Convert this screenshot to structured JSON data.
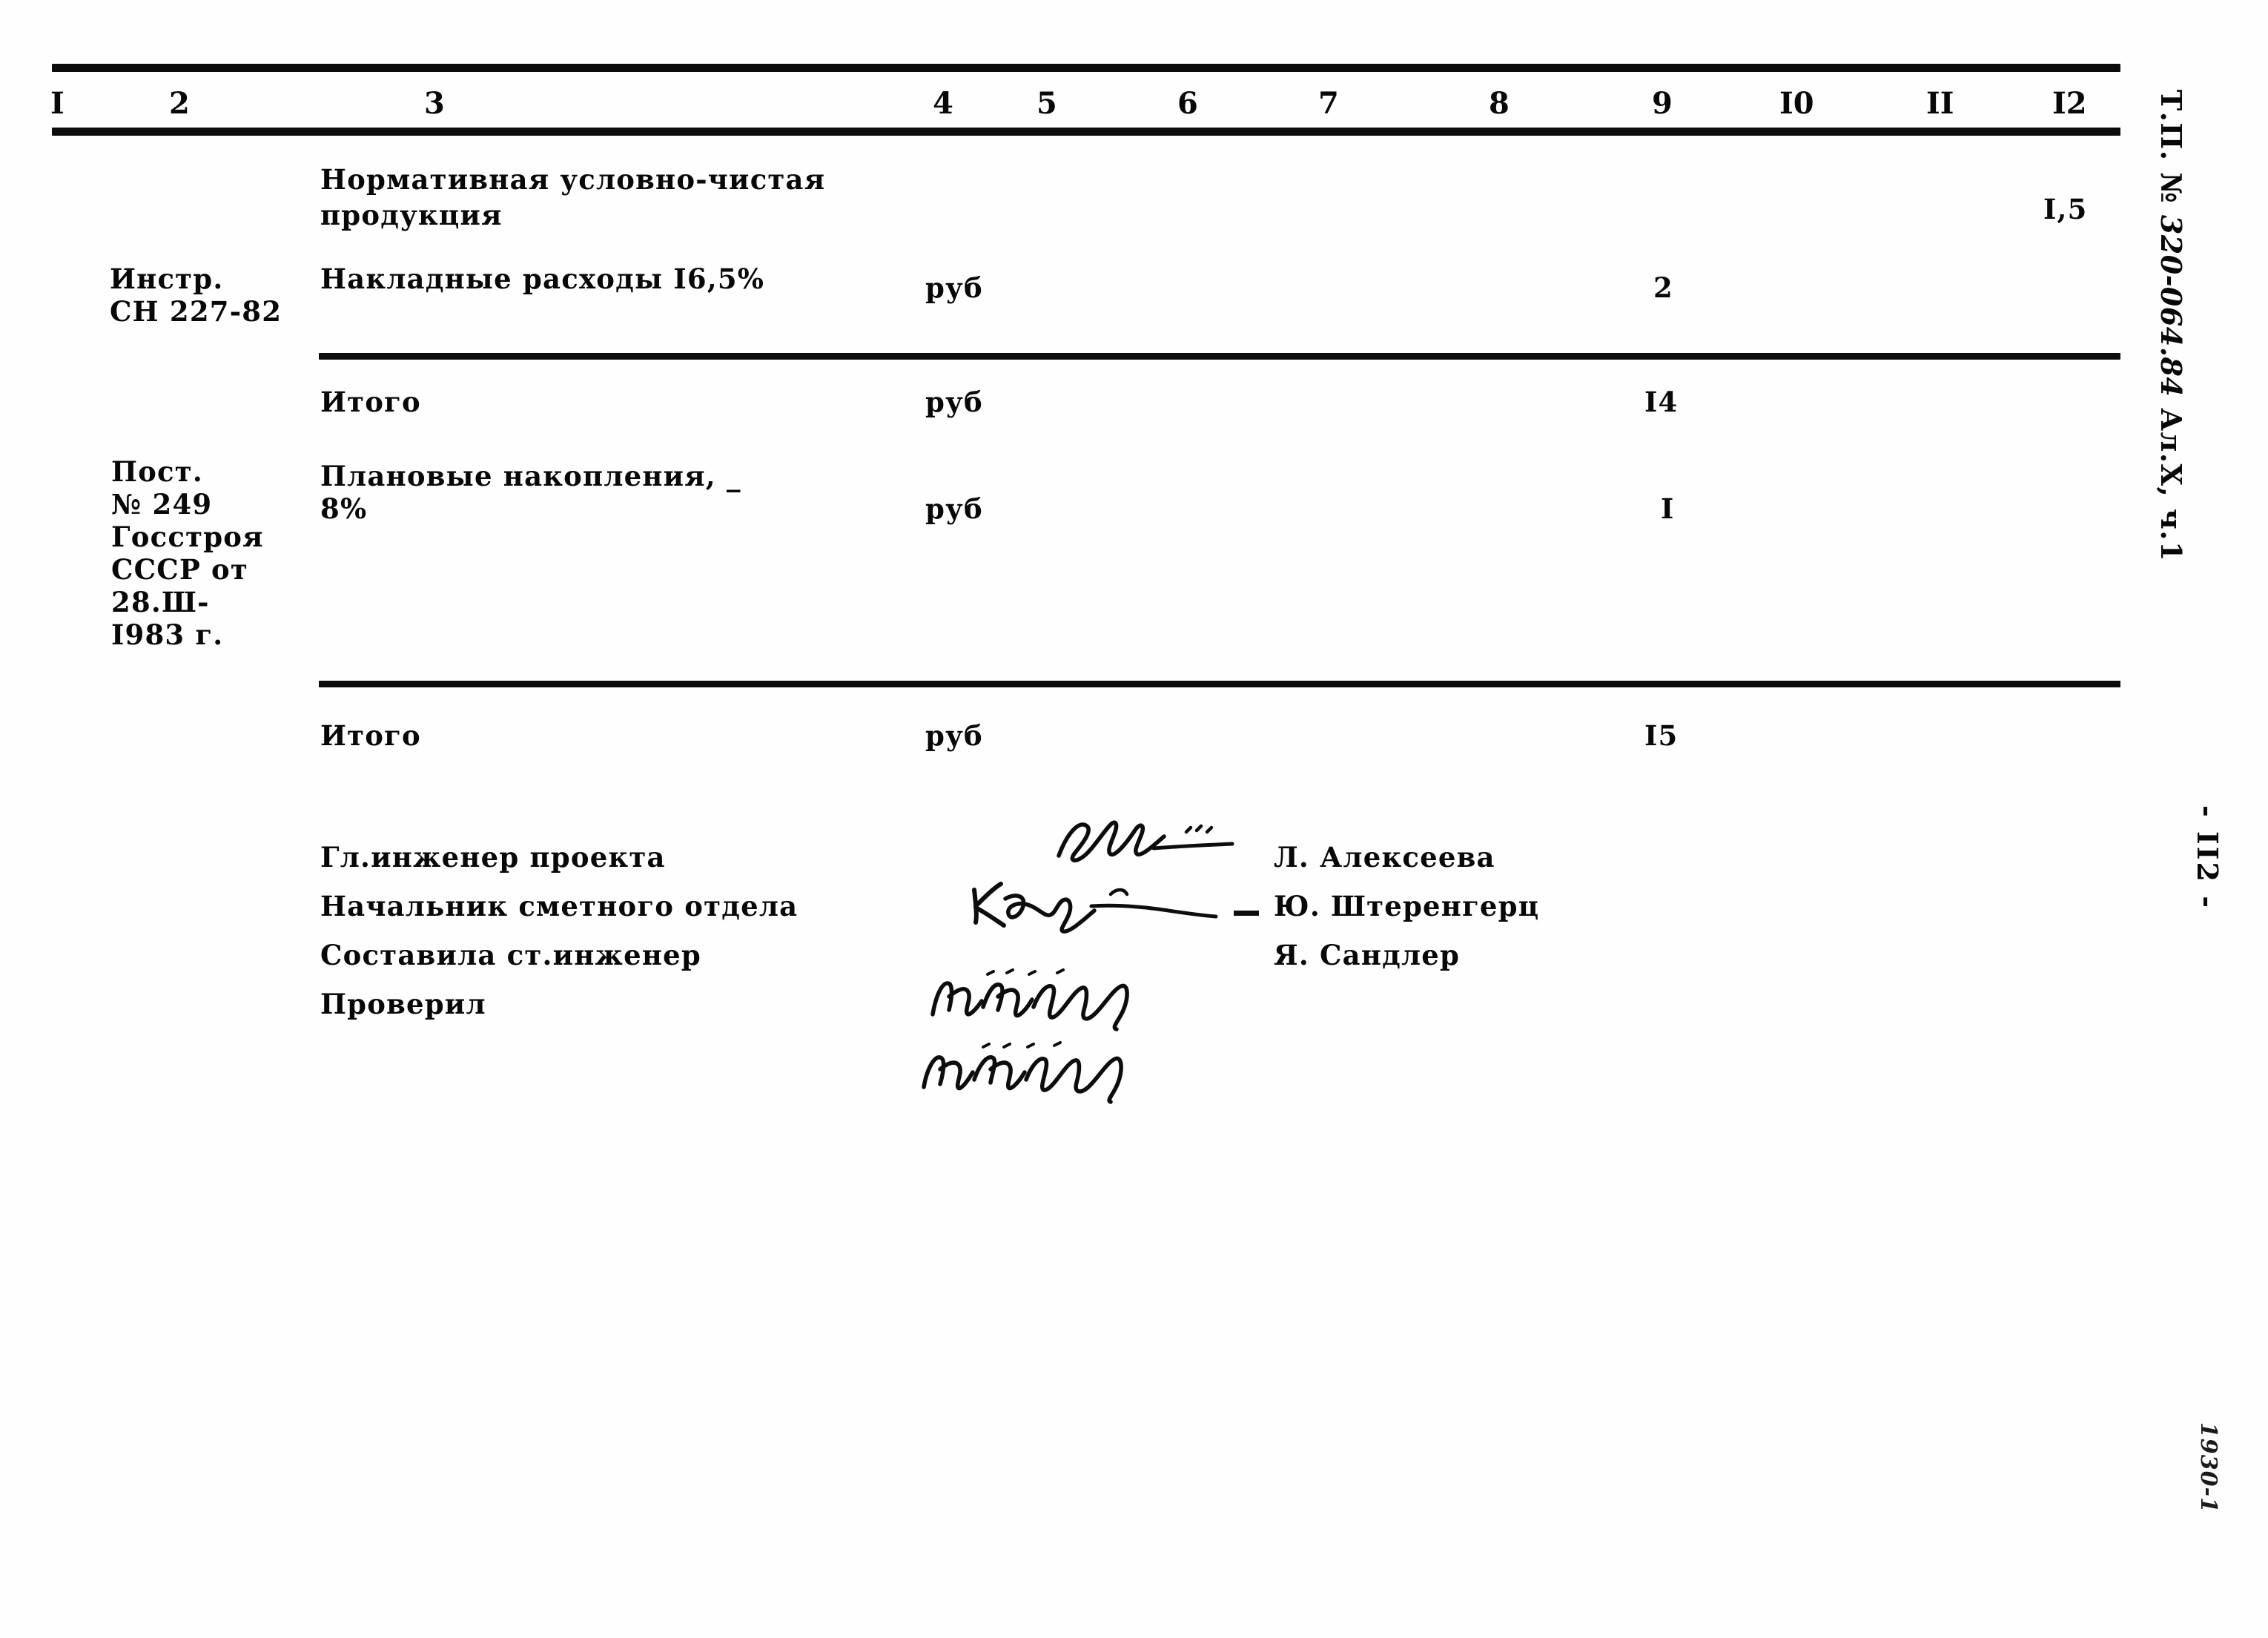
{
  "document": {
    "stamp_code_prefix": "Т.П. № ",
    "stamp_code_handwritten": "320-064.84",
    "stamp_code_suffix": " Ал.Х, ч.1",
    "page_number": "- II2 -",
    "corner_mark": "1930-1"
  },
  "table": {
    "column_numbers": [
      "I",
      "2",
      "3",
      "4",
      "5",
      "6",
      "7",
      "8",
      "9",
      "I0",
      "II",
      "I2"
    ],
    "rows": [
      {
        "justification": "",
        "name_line1": "Нормативная условно-чистая",
        "name_line2": "продукция",
        "unit": "",
        "col9": "",
        "col12": "I,5"
      },
      {
        "justification_line1": "Инстр.",
        "justification_line2": "СН 227-82",
        "name_line1": "Накладные расходы I6,5%",
        "name_line2": "",
        "unit": "руб",
        "col9": "2",
        "col12": ""
      },
      {
        "justification": "",
        "name_line1": "Итого",
        "name_line2": "",
        "unit": "руб",
        "col9": "I4",
        "col12": ""
      },
      {
        "justification_line1": "Пост.",
        "justification_line2": "№ 249",
        "justification_line3": "Госстроя",
        "justification_line4": "СССР от",
        "justification_line5": "28.Ш-",
        "justification_line6": "I983 г.",
        "name_line1": "Плановые накопления, _",
        "name_line2": "8%",
        "unit": "руб",
        "col9": "I",
        "col12": ""
      },
      {
        "justification": "",
        "name_line1": "Итого",
        "name_line2": "",
        "unit": "руб",
        "col9": "I5",
        "col12": ""
      }
    ]
  },
  "signatures": {
    "rows": [
      {
        "role": "Гл.инженер проекта",
        "name": "Л. Алексеева"
      },
      {
        "role": "Начальник сметного отдела",
        "name": "Ю. Штеренгерц"
      },
      {
        "role": "Составила ст.инженер",
        "name": "Я. Сандлер"
      },
      {
        "role": "Проверил",
        "name": ""
      }
    ]
  }
}
